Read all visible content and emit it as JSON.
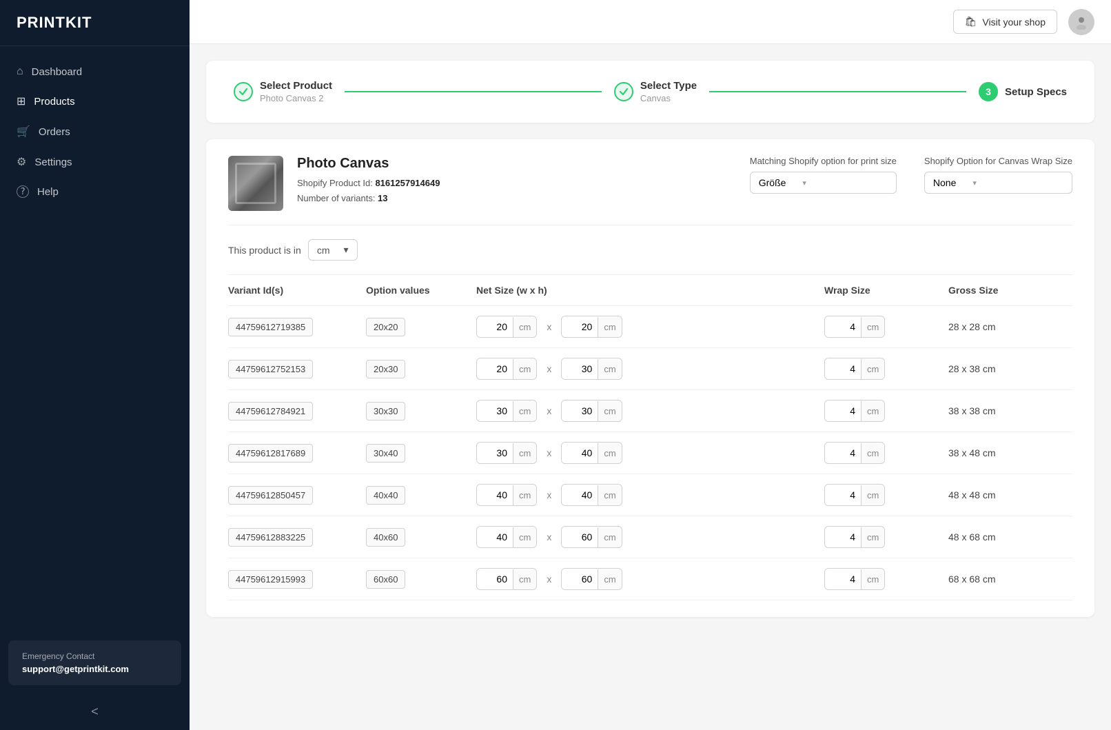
{
  "app": {
    "name": "PRINTKIT"
  },
  "topbar": {
    "visit_shop_label": "Visit your shop",
    "visit_shop_icon": "🛍"
  },
  "sidebar": {
    "nav_items": [
      {
        "id": "dashboard",
        "label": "Dashboard",
        "icon": "⌂"
      },
      {
        "id": "products",
        "label": "Products",
        "icon": "⊞",
        "active": true
      },
      {
        "id": "orders",
        "label": "Orders",
        "icon": "🛒"
      },
      {
        "id": "settings",
        "label": "Settings",
        "icon": "⚙"
      },
      {
        "id": "help",
        "label": "Help",
        "icon": "?"
      }
    ],
    "footer": {
      "label": "Emergency Contact",
      "email": "support@getprintkit.com"
    },
    "collapse_icon": "<"
  },
  "stepper": {
    "steps": [
      {
        "id": "select-product",
        "label": "Select Product",
        "sub": "Photo Canvas 2",
        "state": "done",
        "number": "✓"
      },
      {
        "id": "select-type",
        "label": "Select Type",
        "sub": "Canvas",
        "state": "done",
        "number": "✓"
      },
      {
        "id": "setup-specs",
        "label": "Setup Specs",
        "sub": "",
        "state": "active",
        "number": "3"
      }
    ]
  },
  "product": {
    "name": "Photo Canvas",
    "shopify_id_label": "Shopify Product Id:",
    "shopify_id": "8161257914649",
    "variants_label": "Number of variants:",
    "variants": "13",
    "matching_option_label": "Matching Shopify option for print size",
    "matching_option_value": "Größe",
    "wrap_option_label": "Shopify Option for Canvas Wrap Size",
    "wrap_option_value": "None"
  },
  "unit_row": {
    "prefix": "This product is in",
    "unit": "cm"
  },
  "table": {
    "headers": [
      "Variant Id(s)",
      "Option values",
      "Net Size (w x h)",
      "Wrap Size",
      "Gross Size"
    ],
    "rows": [
      {
        "variant_id": "44759612719385",
        "option": "20x20",
        "net_w": "20",
        "net_h": "20",
        "unit_w": "cm",
        "unit_h": "cm",
        "wrap": "4",
        "wrap_unit": "cm",
        "gross": "28 x 28 cm"
      },
      {
        "variant_id": "44759612752153",
        "option": "20x30",
        "net_w": "20",
        "net_h": "30",
        "unit_w": "cm",
        "unit_h": "cm",
        "wrap": "4",
        "wrap_unit": "cm",
        "gross": "28 x 38 cm"
      },
      {
        "variant_id": "44759612784921",
        "option": "30x30",
        "net_w": "30",
        "net_h": "30",
        "unit_w": "cm",
        "unit_h": "cm",
        "wrap": "4",
        "wrap_unit": "cm",
        "gross": "38 x 38 cm"
      },
      {
        "variant_id": "44759612817689",
        "option": "30x40",
        "net_w": "30",
        "net_h": "40",
        "unit_w": "cm",
        "unit_h": "cm",
        "wrap": "4",
        "wrap_unit": "cm",
        "gross": "38 x 48 cm"
      },
      {
        "variant_id": "44759612850457",
        "option": "40x40",
        "net_w": "40",
        "net_h": "40",
        "unit_w": "cm",
        "unit_h": "cm",
        "wrap": "4",
        "wrap_unit": "cm",
        "gross": "48 x 48 cm"
      },
      {
        "variant_id": "44759612883225",
        "option": "40x60",
        "net_w": "40",
        "net_h": "60",
        "unit_w": "cm",
        "unit_h": "cm",
        "wrap": "4",
        "wrap_unit": "cm",
        "gross": "48 x 68 cm"
      },
      {
        "variant_id": "44759612915993",
        "option": "60x60",
        "net_w": "60",
        "net_h": "60",
        "unit_w": "cm",
        "unit_h": "cm",
        "wrap": "4",
        "wrap_unit": "cm",
        "gross": "68 x 68 cm"
      }
    ]
  }
}
